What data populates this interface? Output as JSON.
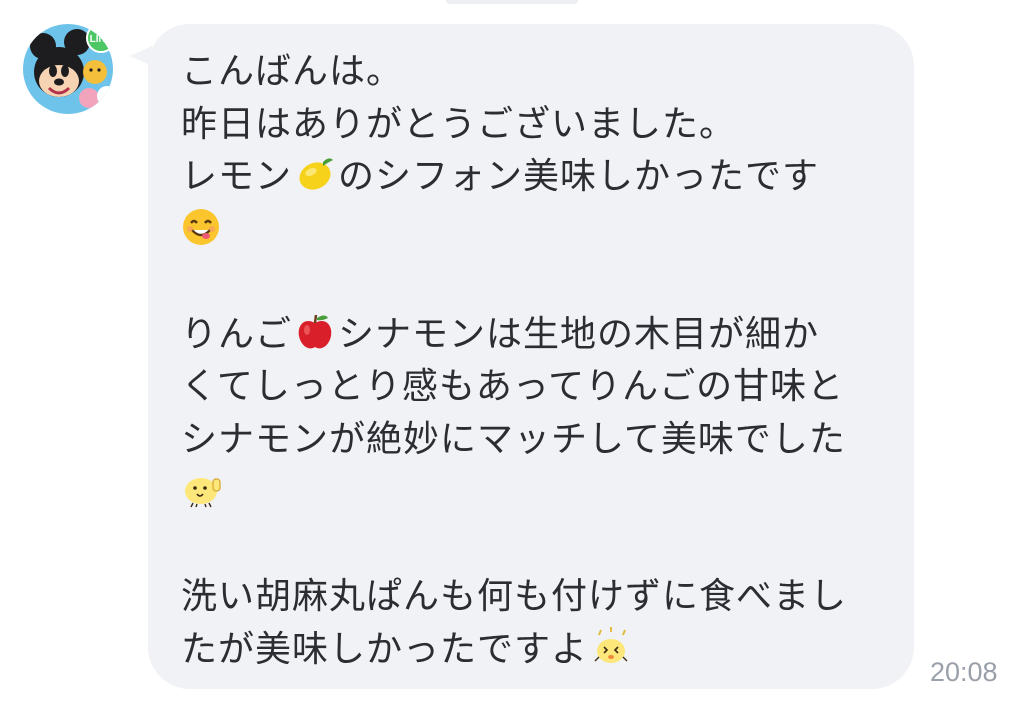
{
  "message": {
    "lines": [
      "こんばんは。",
      "昨日はありがとうございました。",
      "レモン",
      "のシフォン美味しかったです",
      "",
      "りんご",
      "シナモンは生地の木目が細か",
      "くてしっとり感もあってりんごの甘味と",
      "シナモンが絶妙にマッチして美味でした",
      "",
      "洗い胡麻丸ぱんも何も付けずに食べまし",
      "たが美味しかったですよ"
    ],
    "timestamp": "20:08"
  },
  "avatar": {
    "badge": "LINE",
    "icon": "tsum-tsum-avatar"
  },
  "emoji_names": [
    "lemon-emoji",
    "smiling-face-emoji",
    "red-apple-emoji",
    "chick-thumbs-up-sticker",
    "chick-sparkle-sticker"
  ],
  "colors": {
    "bubble": "#f1f2f5",
    "text": "#2b2d33",
    "timestamp": "#9aa0aa",
    "line_green": "#4cc764"
  }
}
